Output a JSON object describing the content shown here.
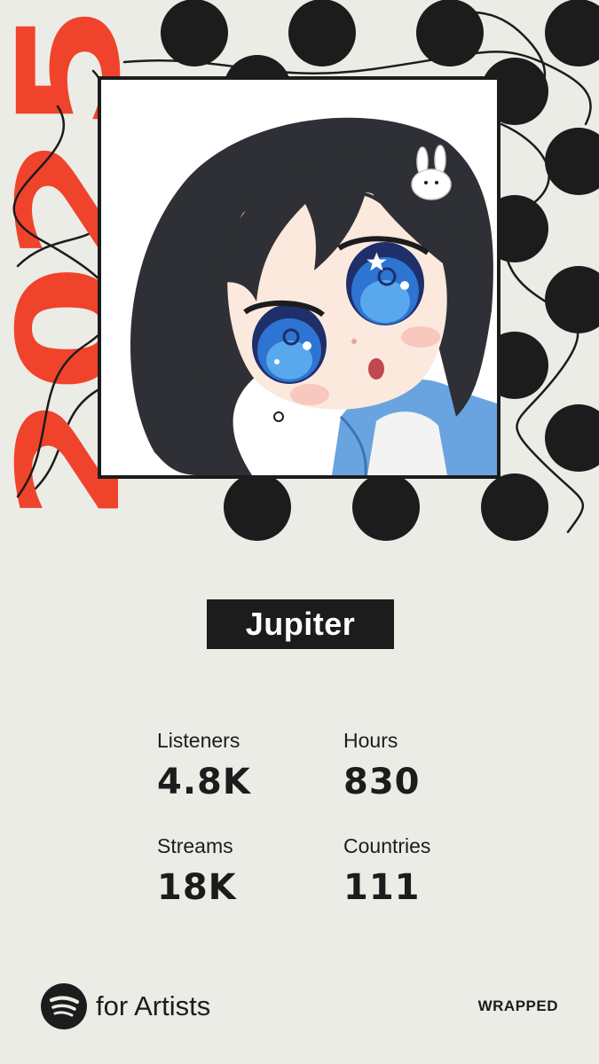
{
  "year": "2025",
  "artist_name": "Jupiter",
  "stats": {
    "listeners": {
      "label": "Listeners",
      "value": "4.8K"
    },
    "hours": {
      "label": "Hours",
      "value": "830"
    },
    "streams": {
      "label": "Streams",
      "value": "18K"
    },
    "countries": {
      "label": "Countries",
      "value": "111"
    }
  },
  "brand": {
    "text": "for Artists",
    "icon": "spotify-logo-icon"
  },
  "tag": "WRAPPED",
  "colors": {
    "background": "#ecece6",
    "accent": "#f0432c",
    "ink": "#1c1c1c"
  }
}
